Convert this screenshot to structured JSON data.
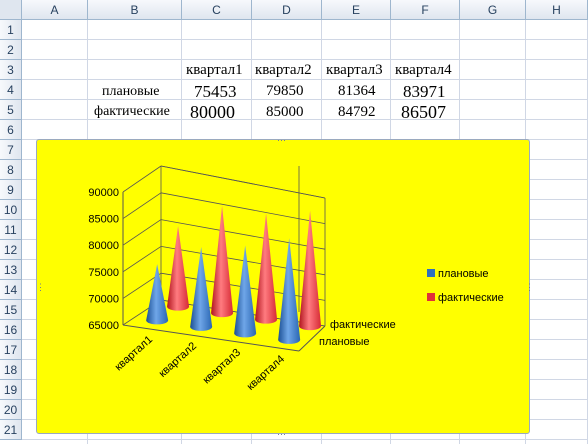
{
  "columns": [
    "A",
    "B",
    "C",
    "D",
    "E",
    "F",
    "G",
    "H"
  ],
  "rows": [
    "1",
    "2",
    "3",
    "4",
    "5",
    "6",
    "7",
    "8",
    "9",
    "10",
    "11",
    "12",
    "13",
    "14",
    "15",
    "16",
    "17",
    "18",
    "19",
    "20",
    "21"
  ],
  "table": {
    "headers": [
      "квартал1",
      "квартал2",
      "квартал3",
      "квартал4"
    ],
    "row_labels": [
      "плановые",
      "фактические"
    ],
    "values": [
      [
        "75453",
        "79850",
        "81364",
        "83971"
      ],
      [
        "80000",
        "85000",
        "84792",
        "86507"
      ]
    ]
  },
  "colors": {
    "chart_bg": "#ffff00",
    "series_blue": "#2e6fbf",
    "series_red": "#e0303a"
  },
  "chart_data": {
    "type": "bar",
    "subtype": "3d-cone",
    "categories": [
      "квартал1",
      "квартал2",
      "квартал3",
      "квартал4"
    ],
    "series": [
      {
        "name": "плановые",
        "values": [
          75453,
          79850,
          81364,
          83971
        ]
      },
      {
        "name": "фактические",
        "values": [
          80000,
          85000,
          84792,
          86507
        ]
      }
    ],
    "y_ticks": [
      "65000",
      "70000",
      "75000",
      "80000",
      "85000",
      "90000"
    ],
    "depth_labels": [
      "фактические",
      "плановые"
    ],
    "ylim": [
      65000,
      90000
    ],
    "legend": [
      "плановые",
      "фактические"
    ],
    "legend_position": "right",
    "grid": true
  }
}
